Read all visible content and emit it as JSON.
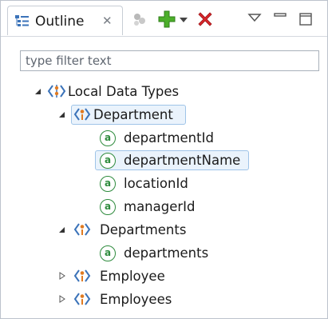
{
  "tab": {
    "title": "Outline",
    "close_glyph": "✕"
  },
  "toolbar": {
    "items": [
      {
        "icon": "hide-fields-icon"
      },
      {
        "icon": "add-icon"
      },
      {
        "icon": "add-dropdown-icon"
      },
      {
        "icon": "delete-icon"
      },
      {
        "icon": "view-menu-icon"
      },
      {
        "icon": "minimize-icon"
      },
      {
        "icon": "maximize-icon"
      }
    ]
  },
  "filter": {
    "placeholder": "type filter text",
    "value": ""
  },
  "tree": {
    "root": {
      "label": "Local Data Types",
      "expanded": true
    },
    "department": {
      "label": "Department",
      "expanded": true,
      "selected": true,
      "fields": [
        "departmentId",
        "departmentName",
        "locationId",
        "managerId"
      ],
      "highlighted_field": "departmentName"
    },
    "departments": {
      "label": "Departments",
      "expanded": true,
      "fields": [
        "departments"
      ]
    },
    "employee": {
      "label": "Employee",
      "expanded": false
    },
    "employees": {
      "label": "Employees",
      "expanded": false
    }
  },
  "colors": {
    "selection_border": "#9fc4e8",
    "selection_fill": "#eaf3fc",
    "attribute_green": "#2e8b3d",
    "add_green": "#4caf2a",
    "delete_red": "#d9262b"
  }
}
